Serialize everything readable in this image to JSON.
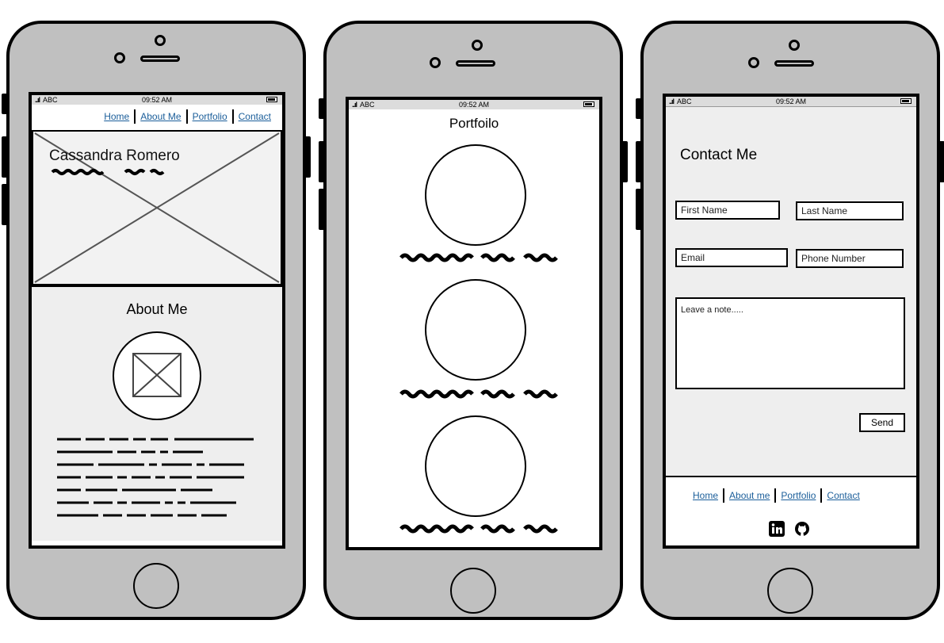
{
  "status_bar": {
    "carrier": "ABC",
    "time": "09:52 AM"
  },
  "phone1": {
    "nav": [
      "Home",
      "About Me",
      "Portfolio",
      "Contact"
    ],
    "hero_name": "Cassandra Romero",
    "about_title": "About Me"
  },
  "phone2": {
    "title": "Portfoilo"
  },
  "phone3": {
    "title": "Contact Me",
    "fields": {
      "first_name": "First Name",
      "last_name": "Last Name",
      "email": "Email",
      "phone": "Phone Number",
      "note": "Leave a note....."
    },
    "send_label": "Send",
    "footer_nav": [
      "Home",
      "About me",
      "Portfolio",
      "Contact"
    ],
    "social_icons": [
      "linkedin-icon",
      "github-icon"
    ]
  },
  "colors": {
    "link": "#1b5e9a",
    "phone_body": "#c0c0c0",
    "section_bg": "#eeeeee"
  }
}
